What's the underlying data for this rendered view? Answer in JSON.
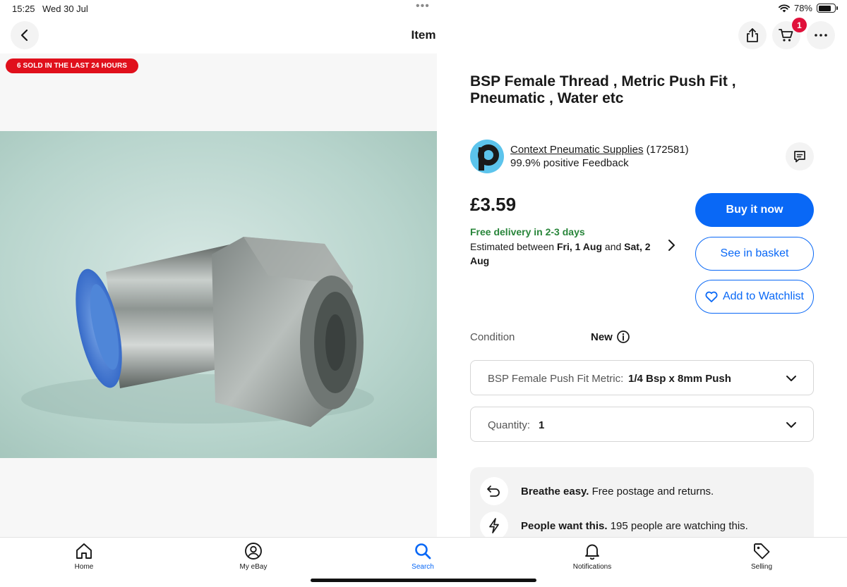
{
  "status_bar": {
    "time": "15:25",
    "date": "Wed 30 Jul",
    "battery_percent": "78%",
    "battery_level": 0.78
  },
  "nav": {
    "title": "Item",
    "cart_count": "1",
    "icons": [
      "chevron-left-icon",
      "share-icon",
      "cart-icon",
      "more-icon"
    ]
  },
  "listing": {
    "sold_badge": "6 SOLD IN THE LAST 24 HOURS",
    "title": "BSP Female Thread , Metric Push Fit , Pneumatic , Water etc",
    "price": "£3.59"
  },
  "seller": {
    "name": "Context Pneumatic Supplies",
    "rating_count": "(172581)",
    "feedback": "99.9% positive Feedback"
  },
  "delivery": {
    "headline": "Free delivery in 2-3 days",
    "prefix": "Estimated between ",
    "date_from": "Fri, 1 Aug",
    "middle": " and ",
    "date_to": "Sat, 2 Aug"
  },
  "actions": {
    "buy_now": "Buy it now",
    "see_basket": "See in basket",
    "add_watchlist": "Add to Watchlist"
  },
  "condition": {
    "label": "Condition",
    "value": "New"
  },
  "variant": {
    "label": "BSP Female Push Fit Metric:",
    "value": "1/4 Bsp x 8mm Push"
  },
  "quantity": {
    "label": "Quantity:",
    "value": "1"
  },
  "highlights": [
    {
      "icon": "return-arrow-icon",
      "bold": "Breathe easy.",
      "text": " Free postage and returns."
    },
    {
      "icon": "lightning-icon",
      "bold": "People want this.",
      "text": " 195 people are watching this."
    }
  ],
  "tabs": [
    {
      "label": "Home",
      "icon": "home-icon"
    },
    {
      "label": "My eBay",
      "icon": "user-icon"
    },
    {
      "label": "Search",
      "icon": "search-icon",
      "active": true
    },
    {
      "label": "Notifications",
      "icon": "bell-icon"
    },
    {
      "label": "Selling",
      "icon": "tag-icon"
    }
  ],
  "colors": {
    "primary": "#0968f6",
    "badge_red": "#e0101c",
    "delivery_green": "#28853a",
    "cart_badge": "#e0103a"
  }
}
